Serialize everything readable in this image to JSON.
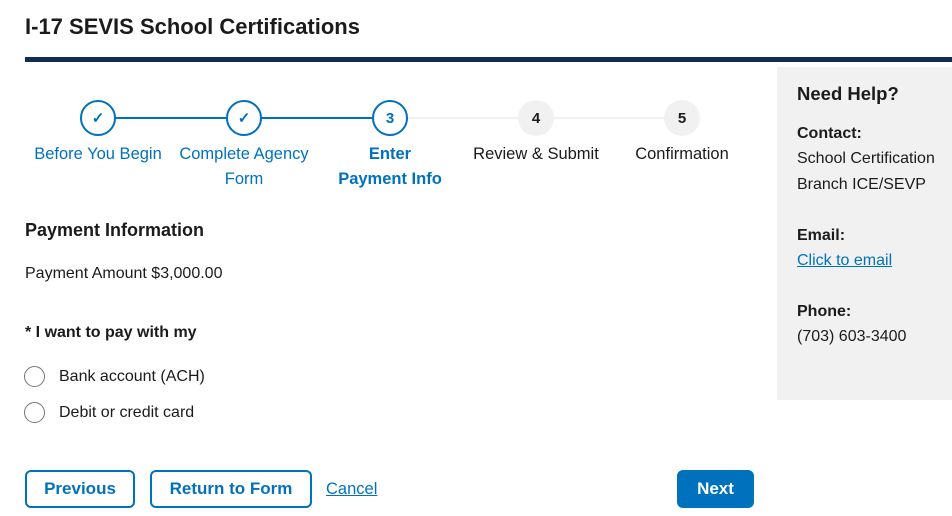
{
  "header": {
    "title": "I-17 SEVIS School Certifications",
    "rule_color": "#112e51"
  },
  "stepper": {
    "accent_color": "#0071bc",
    "steps": [
      {
        "marker": "✓",
        "label": "Before You Begin",
        "status": "done"
      },
      {
        "marker": "✓",
        "label": "Complete Agency Form",
        "status": "done"
      },
      {
        "marker": "3",
        "label": "Enter Payment Info",
        "status": "current"
      },
      {
        "marker": "4",
        "label": "Review & Submit",
        "status": "todo"
      },
      {
        "marker": "5",
        "label": "Confirmation",
        "status": "todo"
      }
    ]
  },
  "payment": {
    "heading": "Payment Information",
    "amount_text": "Payment Amount $3,000.00",
    "question": "* I want to pay with my",
    "options": [
      {
        "label": "Bank account (ACH)",
        "selected": false
      },
      {
        "label": "Debit or credit card",
        "selected": false
      }
    ]
  },
  "actions": {
    "previous": "Previous",
    "return_to_form": "Return to Form",
    "cancel": "Cancel",
    "next": "Next"
  },
  "help": {
    "title": "Need Help?",
    "contact_label": "Contact:",
    "contact_line1": "School Certification",
    "contact_line2": "Branch ICE/SEVP",
    "email_label": "Email:",
    "email_link": "Click to email",
    "phone_label": "Phone:",
    "phone_value": "(703) 603-3400"
  }
}
